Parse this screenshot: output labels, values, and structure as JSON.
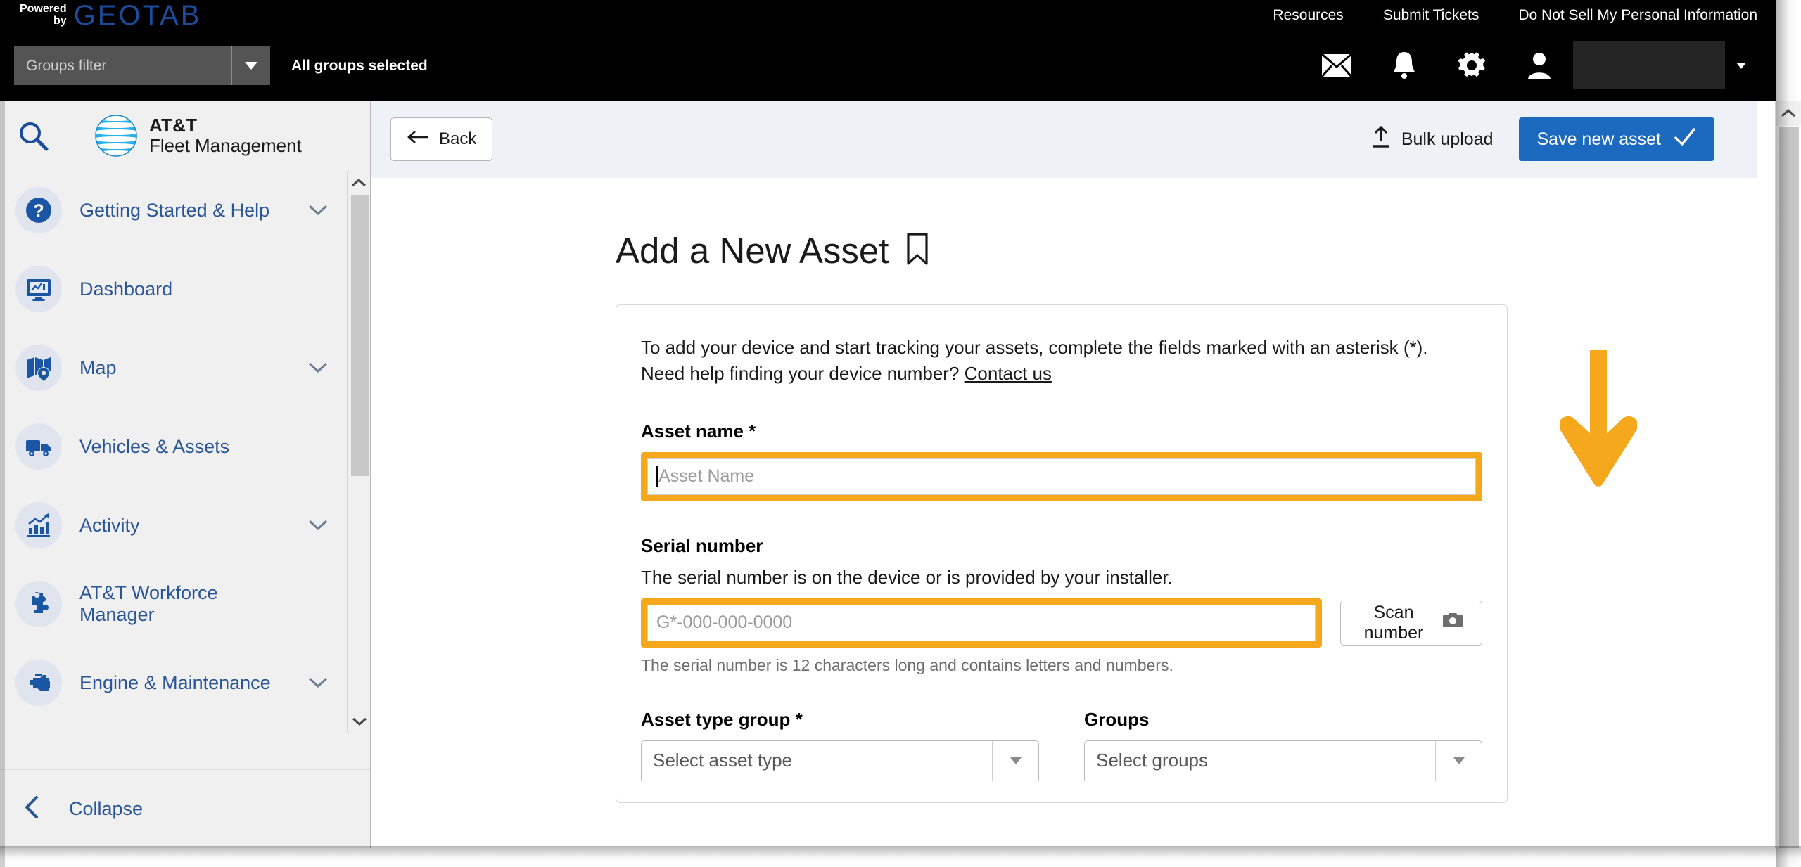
{
  "topbar": {
    "powered_line1": "Powered",
    "powered_line2": "by",
    "brand_word": "GEOTAB",
    "links": [
      {
        "label": "Resources"
      },
      {
        "label": "Submit Tickets"
      },
      {
        "label": "Do Not Sell My Personal Information"
      }
    ],
    "groups_filter_placeholder": "Groups filter",
    "groups_status": "All groups selected",
    "icons": [
      {
        "name": "mail-icon",
        "glyph": "✉"
      },
      {
        "name": "bell-icon",
        "glyph": "🔔"
      },
      {
        "name": "gear-icon",
        "glyph": "⚙"
      },
      {
        "name": "user-icon",
        "glyph": "👤"
      }
    ]
  },
  "sidebar": {
    "brand_line1": "AT&T",
    "brand_line2": "Fleet Management",
    "items": [
      {
        "label": "Getting Started & Help",
        "icon": "question-circle-icon",
        "expandable": true
      },
      {
        "label": "Dashboard",
        "icon": "dashboard-monitor-icon",
        "expandable": false
      },
      {
        "label": "Map",
        "icon": "map-pin-icon",
        "expandable": true
      },
      {
        "label": "Vehicles & Assets",
        "icon": "truck-icon",
        "expandable": false
      },
      {
        "label": "Activity",
        "icon": "chart-bar-icon",
        "expandable": true
      },
      {
        "label": "AT&T Workforce Manager",
        "icon": "puzzle-piece-icon",
        "expandable": false
      },
      {
        "label": "Engine & Maintenance",
        "icon": "engine-icon",
        "expandable": true
      }
    ],
    "collapse_label": "Collapse"
  },
  "toolbar": {
    "back_label": "Back",
    "bulk_upload_label": "Bulk upload",
    "save_label": "Save new asset"
  },
  "main": {
    "page_title": "Add a New Asset",
    "intro_line1": "To add your device and start tracking your assets, complete the fields marked with an asterisk (*).",
    "intro_line2_prefix": "Need help finding your device number? ",
    "intro_link": "Contact us",
    "asset_name": {
      "label": "Asset name *",
      "placeholder": "Asset Name",
      "value": ""
    },
    "serial_number": {
      "label": "Serial number",
      "note": "The serial number is on the device or is provided by your installer.",
      "placeholder": "G*-000-000-0000",
      "value": "",
      "help": "The serial number is 12 characters long and contains letters and numbers.",
      "scan_label": "Scan number"
    },
    "asset_type_group": {
      "label": "Asset type group *",
      "value": "Select asset type"
    },
    "groups": {
      "label": "Groups",
      "value": "Select groups"
    }
  },
  "annotations": {
    "arrow_direction": "down",
    "arrow_color": "#F5A81C"
  },
  "colors": {
    "highlight_orange": "#F5A81C",
    "primary_blue": "#1B6AC0",
    "nav_blue": "#2A5699",
    "geotab_blue": "#1B4C9C",
    "topbar_black": "#000000",
    "toolbar_bg": "#EEF1F6",
    "sidebar_bg": "#F0F0F0"
  }
}
